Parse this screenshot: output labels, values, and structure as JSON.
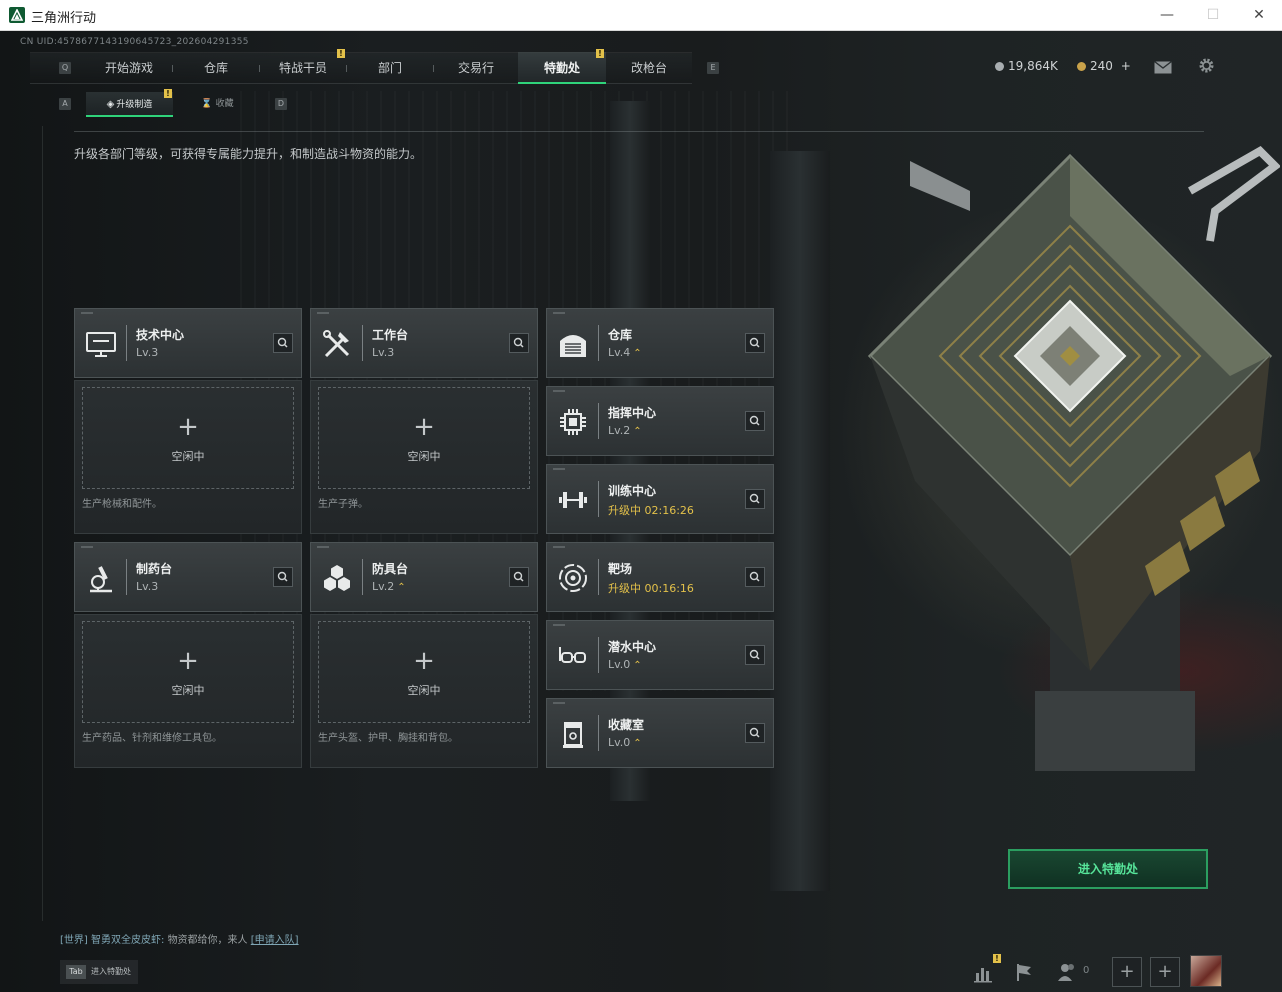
{
  "window": {
    "title": "三角洲行动",
    "minimize": "—",
    "maximize": "☐",
    "close": "✕"
  },
  "uid": "CN UID:4578677143190645723_202604291355",
  "nav": {
    "tabs": [
      {
        "label": "开始游戏"
      },
      {
        "label": "仓库"
      },
      {
        "label": "特战干员",
        "badge": "!"
      },
      {
        "label": "部门"
      },
      {
        "label": "交易行"
      },
      {
        "label": "特勤处",
        "badge": "!",
        "active": true
      },
      {
        "label": "改枪台"
      }
    ],
    "key_left": "Q",
    "key_right": "E"
  },
  "currency": {
    "coins": "19,864K",
    "tokens": "240",
    "add": "+"
  },
  "subnav": {
    "tabs": [
      {
        "label": "升级制造",
        "badge": "!",
        "active": true
      },
      {
        "label": "收藏"
      }
    ],
    "key_left": "A",
    "key_right": "D"
  },
  "description": "升级各部门等级，可获得专属能力提升，和制造战斗物资的能力。",
  "departments": {
    "tech": {
      "name": "技术中心",
      "level": "Lv.3",
      "icon": "computer-icon"
    },
    "workbench": {
      "name": "工作台",
      "level": "Lv.3",
      "icon": "tools-icon"
    },
    "pharmacy": {
      "name": "制药台",
      "level": "Lv.3",
      "icon": "microscope-icon"
    },
    "armor": {
      "name": "防具台",
      "level": "Lv.2",
      "icon": "hexagon-icon",
      "upgrade": "⌃"
    },
    "warehouse": {
      "name": "仓库",
      "level": "Lv.4",
      "icon": "hangar-icon",
      "upgrade": "⌃"
    },
    "command": {
      "name": "指挥中心",
      "level": "Lv.2",
      "icon": "chip-icon",
      "upgrade": "⌃"
    },
    "training": {
      "name": "训练中心",
      "level": "升级中 02:16:26",
      "icon": "dumbbell-icon"
    },
    "range": {
      "name": "靶场",
      "level": "升级中 00:16:16",
      "icon": "target-icon"
    },
    "diving": {
      "name": "潜水中心",
      "level": "Lv.0",
      "icon": "goggles-icon",
      "upgrade": "⌃"
    },
    "collection": {
      "name": "收藏室",
      "level": "Lv.0",
      "icon": "cabinet-icon",
      "upgrade": "⌃"
    }
  },
  "production": {
    "tech": {
      "idle": "空闲中",
      "plus": "+",
      "desc": "生产枪械和配件。"
    },
    "workbench": {
      "idle": "空闲中",
      "plus": "+",
      "desc": "生产子弹。"
    },
    "pharmacy": {
      "idle": "空闲中",
      "plus": "+",
      "desc": "生产药品、针剂和维修工具包。"
    },
    "armor": {
      "idle": "空闲中",
      "plus": "+",
      "desc": "生产头盔、护甲、胸挂和背包。"
    }
  },
  "enter_button": "进入特勤处",
  "chat": {
    "channel": "[世界]",
    "user": "智勇双全皮皮虾:",
    "message": "物资都给你，来人",
    "action": "[申请入队]"
  },
  "tab_hint": {
    "key": "Tab",
    "label": "进入特勤处"
  },
  "bottom_bar": {
    "friends_count": "0",
    "add1": "+",
    "add2": "+",
    "badge": "!"
  },
  "colors": {
    "accent_green": "#2fd37a",
    "upgrade_gold": "#e3c14a",
    "card_bg": "#34393b"
  }
}
